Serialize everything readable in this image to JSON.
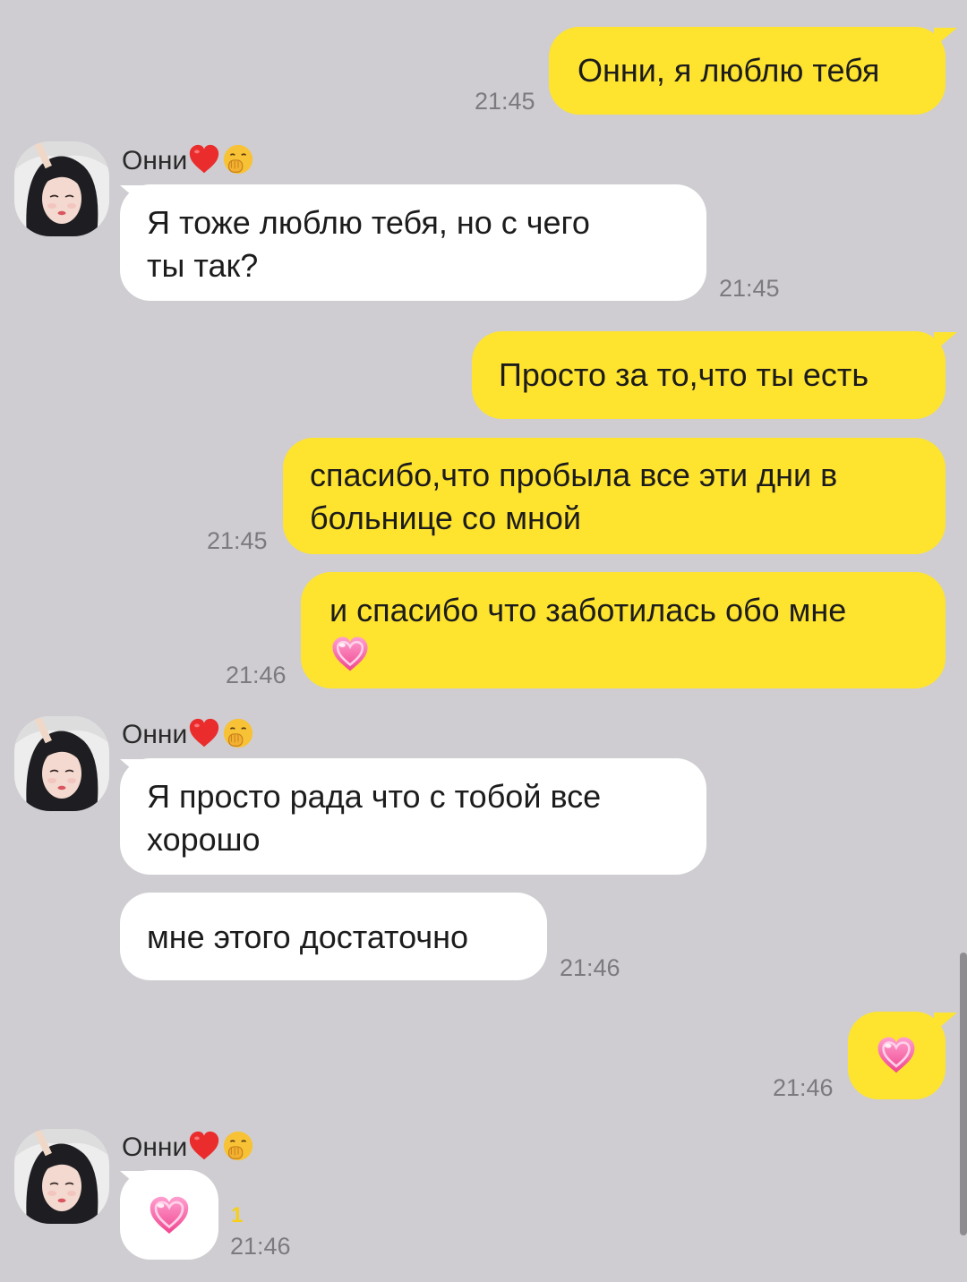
{
  "messages": [
    {
      "text": "Онни, я люблю тебя",
      "time": "21:45"
    },
    {
      "sender": "Онни",
      "text_l1": "Я тоже люблю тебя, но с чего",
      "text_l2": "ты так?",
      "time": "21:45"
    },
    {
      "text": "Просто за то,что ты есть"
    },
    {
      "text_l1": "спасибо,что пробыла все эти дни в",
      "text_l2": "больнице со мной",
      "time": "21:45"
    },
    {
      "text": "и спасибо что заботилась обо мне",
      "emoji": "sparkling-heart",
      "time": "21:46"
    },
    {
      "sender": "Онни",
      "text_l1": "Я просто рада что с тобой все",
      "text_l2": "хорошо"
    },
    {
      "text": "мне этого достаточно",
      "time": "21:46"
    },
    {
      "emoji": "sparkling-heart",
      "time": "21:46"
    },
    {
      "sender": "Онни",
      "emoji": "sparkling-heart",
      "unread": "1",
      "time": "21:46"
    }
  ],
  "colors": {
    "background": "#cfcdd1",
    "outgoing_bubble": "#fee32f",
    "incoming_bubble": "#ffffff",
    "unread_count": "#f6cf1a"
  }
}
